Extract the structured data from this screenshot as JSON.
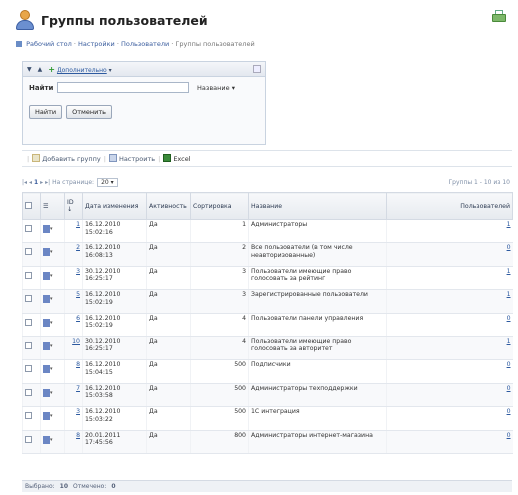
{
  "header": {
    "title": "Группы пользователей",
    "icon": "users-group-icon",
    "print_icon": "print-icon"
  },
  "breadcrumb": [
    "Рабочий стол",
    "Настройки",
    "Пользователи",
    "Группы пользователей"
  ],
  "filter": {
    "toolbar": {
      "more_label": "Дополнительно"
    },
    "find_label": "Найти",
    "search_value": "",
    "field_select": "Название",
    "find_button": "Найти",
    "cancel_button": "Отменить"
  },
  "actions": {
    "add_group": "Добавить группу",
    "settings": "Настроить",
    "excel": "Excel"
  },
  "pager": {
    "page": "1",
    "per_page_label": "На странице:",
    "per_page": "20",
    "range": "Группы 1 - 10 из 10"
  },
  "table": {
    "headers": {
      "id": "ID",
      "date": "Дата изменения",
      "active": "Активность",
      "sort": "Сортировка",
      "name": "Название",
      "users": "Пользователей"
    },
    "rows": [
      {
        "id": "1",
        "date": "16.12.2010 15:02:16",
        "active": "Да",
        "sort": "1",
        "name": "Администраторы",
        "users": "1"
      },
      {
        "id": "2",
        "date": "16.12.2010 16:08:13",
        "active": "Да",
        "sort": "2",
        "name": "Все пользователи (в том числе неавторизованные)",
        "users": "0"
      },
      {
        "id": "3",
        "date": "30.12.2010 16:25:17",
        "active": "Да",
        "sort": "3",
        "name": "Пользователи имеющие право голосовать за рейтинг",
        "users": "1"
      },
      {
        "id": "5",
        "date": "16.12.2010 15:02:19",
        "active": "Да",
        "sort": "3",
        "name": "Зарегистрированные пользователи",
        "users": "1"
      },
      {
        "id": "6",
        "date": "16.12.2010 15:02:19",
        "active": "Да",
        "sort": "4",
        "name": "Пользователи панели управления",
        "users": "0"
      },
      {
        "id": "10",
        "date": "30.12.2010 16:25:17",
        "active": "Да",
        "sort": "4",
        "name": "Пользователи имеющие право голосовать за авторитет",
        "users": "1"
      },
      {
        "id": "8",
        "date": "16.12.2010 15:04:15",
        "active": "Да",
        "sort": "500",
        "name": "Подписчики",
        "users": "0"
      },
      {
        "id": "7",
        "date": "16.12.2010 15:03:58",
        "active": "Да",
        "sort": "500",
        "name": "Администраторы техподдержки",
        "users": "0"
      },
      {
        "id": "3",
        "date": "16.12.2010 15:03:22",
        "active": "Да",
        "sort": "500",
        "name": "1С интеграция",
        "users": "0"
      },
      {
        "id": "8",
        "date": "20.01.2011 17:45:56",
        "active": "Да",
        "sort": "800",
        "name": "Администраторы интернет-магазина",
        "users": "0"
      }
    ]
  },
  "footer": {
    "selected_label": "Выбрано:",
    "selected": "10",
    "checked_label": "Отмечено:",
    "checked": "0"
  }
}
